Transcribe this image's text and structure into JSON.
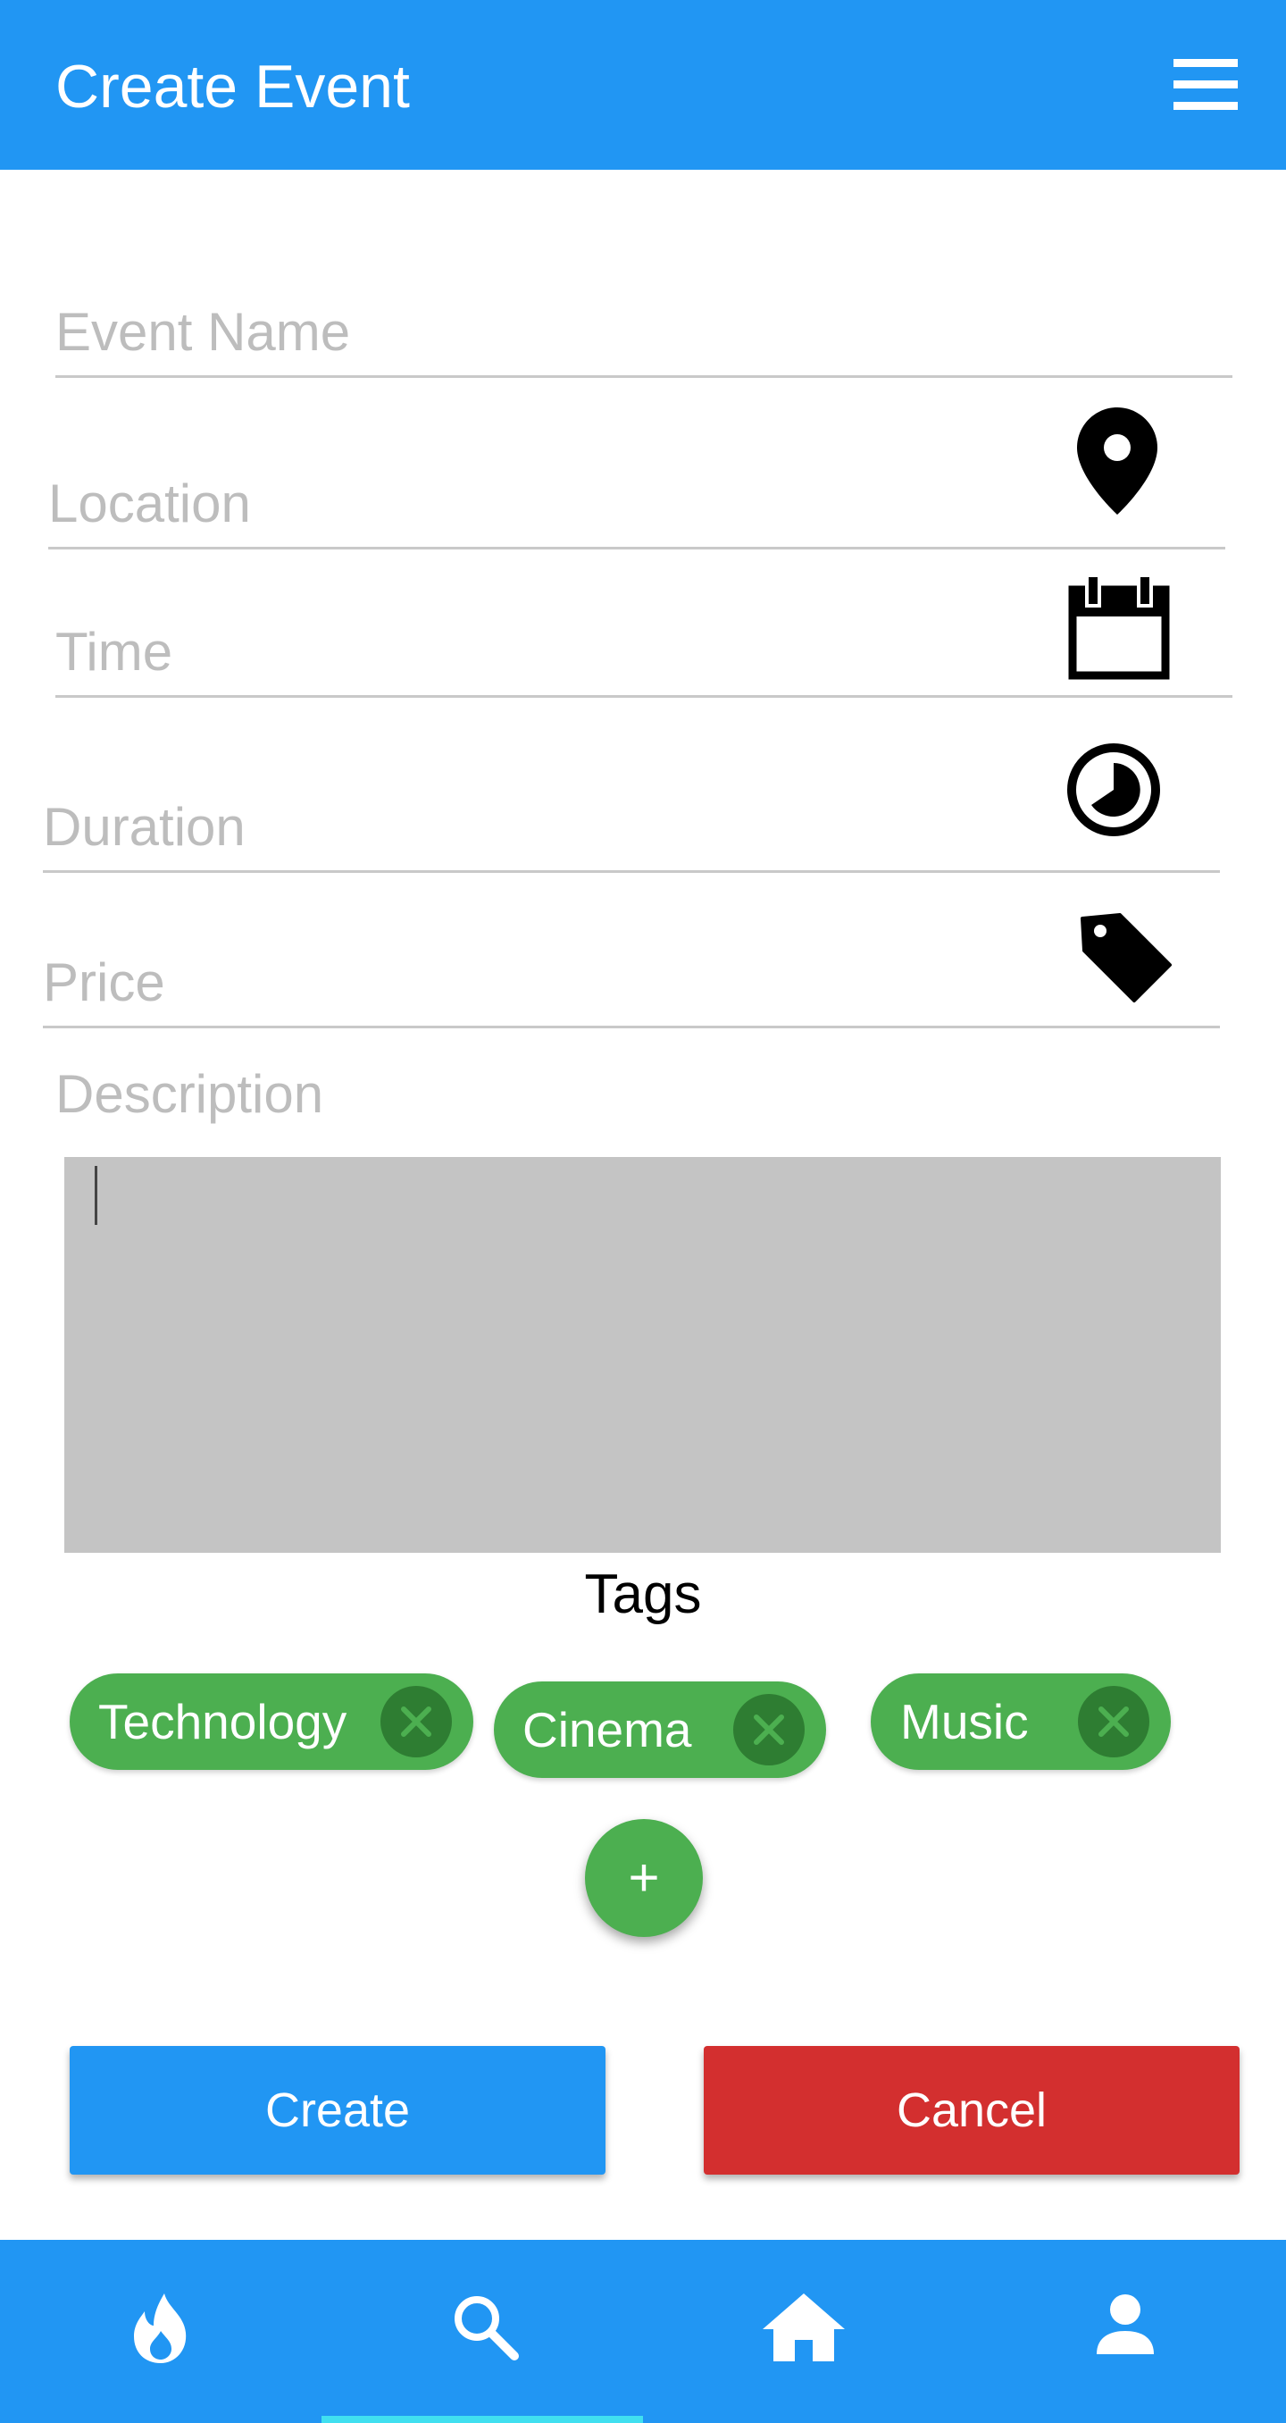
{
  "appbar": {
    "title": "Create Event",
    "menu_icon": "menu-icon"
  },
  "form": {
    "event_name": {
      "placeholder": "Event Name",
      "value": ""
    },
    "location": {
      "placeholder": "Location",
      "value": "",
      "icon": "location-pin-icon"
    },
    "time": {
      "placeholder": "Time",
      "value": "",
      "icon": "calendar-icon"
    },
    "duration": {
      "placeholder": "Duration",
      "value": "",
      "icon": "clock-icon"
    },
    "price": {
      "placeholder": "Price",
      "value": "",
      "icon": "price-tag-icon"
    },
    "description": {
      "label": "Description",
      "value": ""
    }
  },
  "tags": {
    "title": "Tags",
    "items": [
      {
        "label": "Technology"
      },
      {
        "label": "Cinema"
      },
      {
        "label": "Music"
      }
    ],
    "add_label": "+",
    "remove_icon": "close-icon"
  },
  "actions": {
    "create_label": "Create",
    "cancel_label": "Cancel"
  },
  "bottom_nav": {
    "items": [
      {
        "icon": "flame-icon"
      },
      {
        "icon": "search-icon"
      },
      {
        "icon": "home-icon"
      },
      {
        "icon": "person-icon"
      }
    ],
    "active_index": 1
  },
  "colors": {
    "primary": "#2196F3",
    "tag_green": "#4CAF50",
    "tag_close": "#2E7D32",
    "cancel_red": "#D32F2F",
    "active_indicator": "#40E0F0",
    "placeholder": "#BDBDBD",
    "description_bg": "#C4C4C4"
  }
}
